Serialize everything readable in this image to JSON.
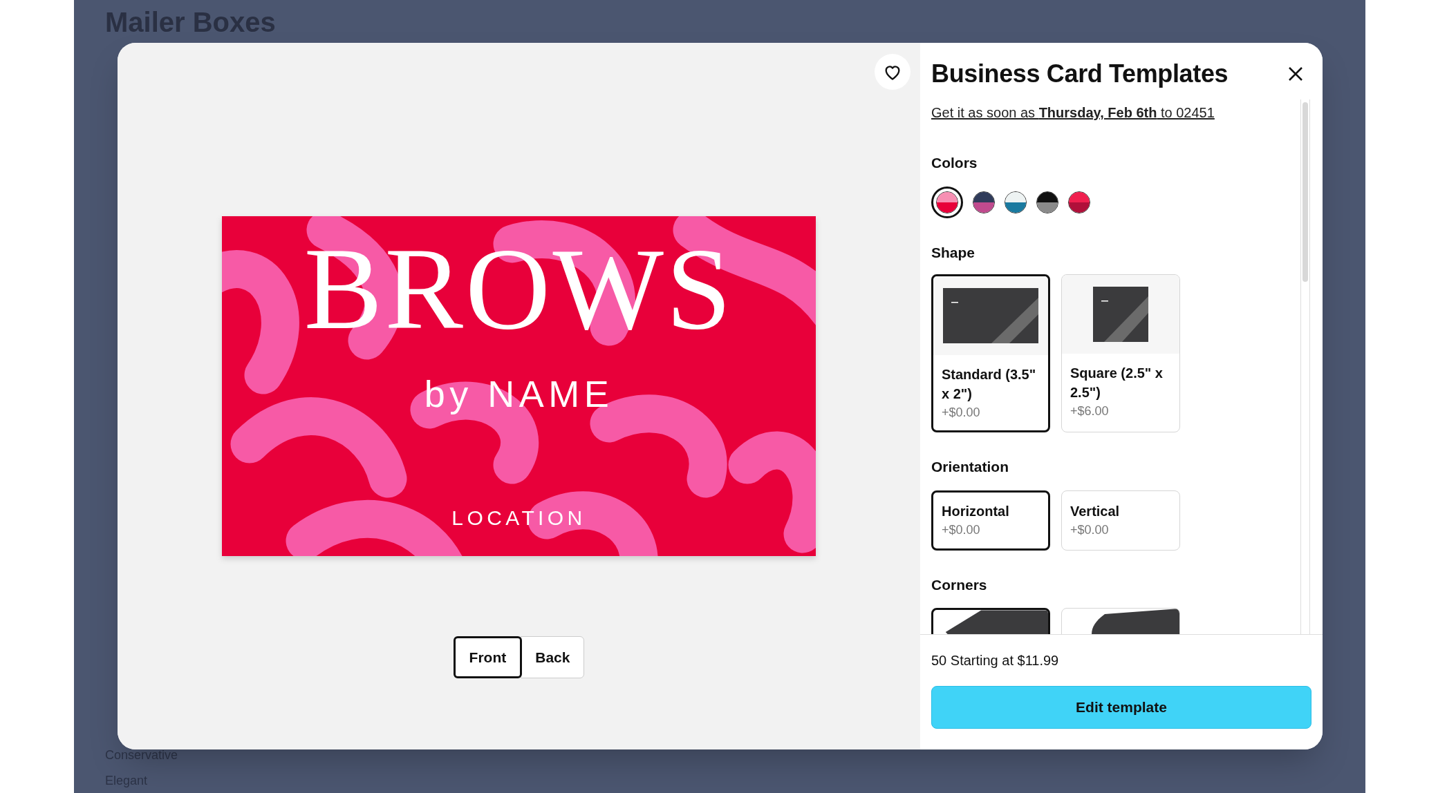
{
  "background_page": {
    "title": "Mailer Boxes",
    "filter_items": [
      "Conservative",
      "Elegant"
    ]
  },
  "preview": {
    "card_texts": {
      "name": "BROWS",
      "subtitle": "by NAME",
      "location": "LOCATION"
    },
    "favorite": false,
    "sides": [
      {
        "label": "Front",
        "selected": true
      },
      {
        "label": "Back",
        "selected": false
      }
    ]
  },
  "panel": {
    "title": "Business Card Templates",
    "delivery": "Get it as soon as **Thursday, Feb 6th** to 02451",
    "colors_label": "Colors",
    "colors": [
      {
        "halves": [
          {
            "color": "#f78fb3"
          },
          {
            "color": "#e8003a"
          }
        ],
        "selected": true
      },
      {
        "halves": [
          {
            "color": "#2f3b5a"
          },
          {
            "color": "#c04a8e"
          }
        ],
        "selected": false
      },
      {
        "halves": [
          {
            "color": "#eef3f3"
          },
          {
            "color": "#1a7aa0"
          }
        ],
        "selected": false
      },
      {
        "halves": [
          {
            "color": "#111111"
          },
          {
            "color": "#8a8a8a"
          }
        ],
        "selected": false
      },
      {
        "halves": [
          {
            "color": "#f0204f"
          },
          {
            "color": "#b0103a"
          }
        ],
        "selected": false
      }
    ],
    "shape_label": "Shape",
    "shapes": [
      {
        "kind": "landscape",
        "label": "Standard (3.5\" x 2\")",
        "price": "+$0.00",
        "selected": true
      },
      {
        "kind": "square",
        "label": "Square (2.5\" x 2.5\")",
        "price": "+$6.00",
        "selected": false
      }
    ],
    "orientation_label": "Orientation",
    "orientations": [
      {
        "label": "Horizontal",
        "price": "+$0.00",
        "selected": true
      },
      {
        "label": "Vertical",
        "price": "+$0.00",
        "selected": false
      }
    ],
    "corners_label": "Corners",
    "corners": [
      {
        "kind": "square",
        "selected": true
      },
      {
        "kind": "rounded",
        "selected": false
      }
    ],
    "price_summary": "50 Starting at $11.99",
    "action": "Edit template"
  }
}
